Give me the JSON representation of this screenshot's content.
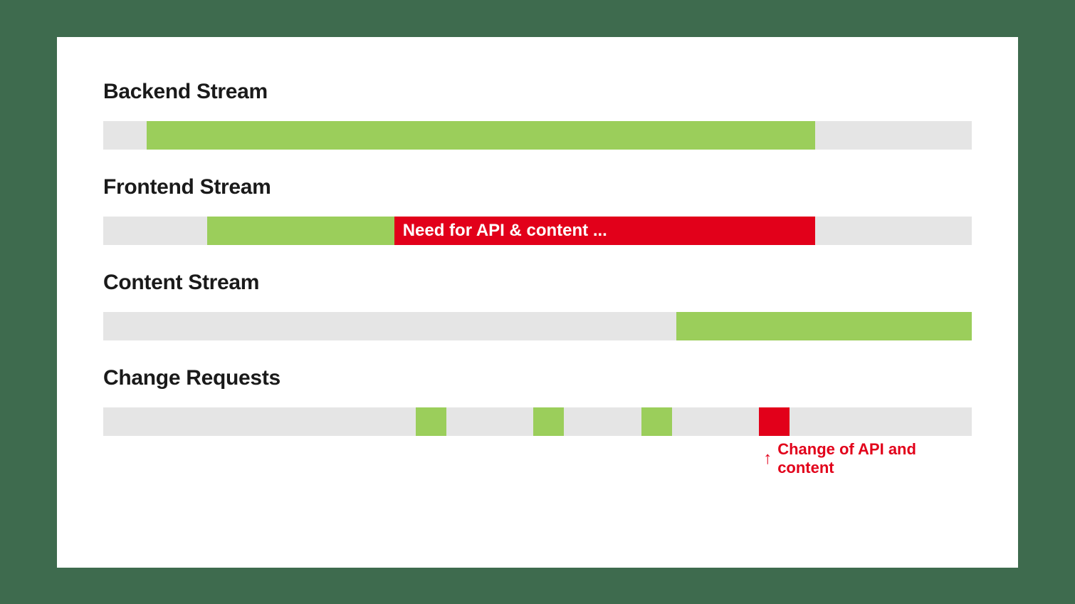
{
  "colors": {
    "background": "#3e6b4e",
    "card": "#ffffff",
    "track": "#e5e5e5",
    "green": "#9bce5b",
    "red": "#e2001a",
    "text": "#1a1a1a"
  },
  "chart_data": {
    "type": "bar",
    "orientation": "horizontal-timeline",
    "x_range": [
      0,
      100
    ],
    "streams": [
      {
        "name": "Backend Stream",
        "segments": [
          {
            "start": 5,
            "end": 82,
            "status": "green",
            "label": ""
          }
        ]
      },
      {
        "name": "Frontend Stream",
        "segments": [
          {
            "start": 12,
            "end": 33.5,
            "status": "green",
            "label": ""
          },
          {
            "start": 33.5,
            "end": 82,
            "status": "red",
            "label": "Need for API & content ..."
          }
        ]
      },
      {
        "name": "Content Stream",
        "segments": [
          {
            "start": 66,
            "end": 100,
            "status": "green",
            "label": ""
          }
        ]
      },
      {
        "name": "Change Requests",
        "segments": [
          {
            "start": 36,
            "end": 39.5,
            "status": "green",
            "label": ""
          },
          {
            "start": 49.5,
            "end": 53,
            "status": "green",
            "label": ""
          },
          {
            "start": 62,
            "end": 65.5,
            "status": "green",
            "label": ""
          },
          {
            "start": 75.5,
            "end": 79,
            "status": "red",
            "label": ""
          }
        ],
        "annotation": {
          "text": "Change of API and content",
          "points_to_segment_index": 3
        }
      }
    ]
  }
}
